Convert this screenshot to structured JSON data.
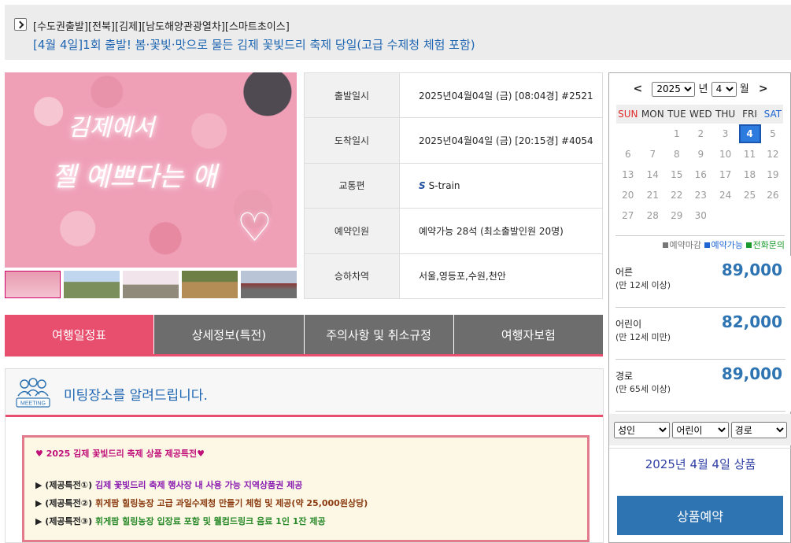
{
  "header": {
    "category": "[수도권출발][전북][김제][남도해양관광열차][스마트초이스]",
    "title": "[4월 4일]1회 출발! 봄·꽃빛·맛으로 물든 김제 꽃빛드리 축제 당일(고급 수제청 체험 포함)"
  },
  "gallery": {
    "photo_text_line1": "김제에서",
    "photo_text_line2": "젤 예쁘다는 애"
  },
  "info": {
    "rows": [
      {
        "label": "출발일시",
        "value": "2025년04월04일 (금) [08:04경] #2521"
      },
      {
        "label": "도착일시",
        "value": "2025년04월04일 (금) [20:15경] #4054"
      },
      {
        "label": "교통편",
        "value": "S-train",
        "logo": "S"
      },
      {
        "label": "예약인원",
        "value": "예약가능 28석 (최소출발인원  20명)"
      },
      {
        "label": "승하차역",
        "value": "서울,영등포,수원,천안"
      }
    ]
  },
  "tabs": [
    "여행일정표",
    "상세정보(특전)",
    "주의사항 및 취소규정",
    "여행자보험"
  ],
  "meeting": {
    "icon_label": "MEETING",
    "title": "미팅장소를 알려드립니다."
  },
  "benefit": {
    "head": "♥ 2025 김제 꽃빛드리 축제 상품 제공특전♥",
    "items": [
      {
        "prefix": "▶ (제공특전①) ",
        "text": "김제 꽃빛드리 축제 행사장 내 사용 가능 지역상품권 제공"
      },
      {
        "prefix": "▶ (제공특전②) ",
        "text": "휘게팜 힐링농장 고급 과일수제청 만들기 체험 및 제공(약 25,000원상당)"
      },
      {
        "prefix": "▶ (제공특전③) ",
        "text": "휘게팜 힐링농장 입장료 포함 및 웰컴드링크 음료 1인 1잔 제공"
      }
    ]
  },
  "calendar": {
    "prev": "<",
    "next": ">",
    "year": "2025",
    "year_unit": "년",
    "month": "4",
    "month_unit": "월",
    "weekdays": [
      "SUN",
      "MON",
      "TUE",
      "WED",
      "THU",
      "FRI",
      "SAT"
    ],
    "weeks": [
      [
        "",
        "",
        "1",
        "2",
        "3",
        "4",
        "5"
      ],
      [
        "6",
        "7",
        "8",
        "9",
        "10",
        "11",
        "12"
      ],
      [
        "13",
        "14",
        "15",
        "16",
        "17",
        "18",
        "19"
      ],
      [
        "20",
        "21",
        "22",
        "23",
        "24",
        "25",
        "26"
      ],
      [
        "27",
        "28",
        "29",
        "30",
        "",
        "",
        ""
      ]
    ],
    "selected_day": "4",
    "legend": [
      "예약마감",
      "예약가능",
      "전화문의"
    ]
  },
  "prices": [
    {
      "name": "어른",
      "cond": "(만 12세 이상)",
      "amount": "89,000"
    },
    {
      "name": "어린이",
      "cond": "(만 12세 미만)",
      "amount": "82,000"
    },
    {
      "name": "경로",
      "cond": "(만 65세 이상)",
      "amount": "89,000"
    }
  ],
  "selects": [
    "성인",
    "어린이",
    "경로"
  ],
  "product_date": "2025년 4월 4일 상품",
  "reserve_label": "상품예약",
  "colors": {
    "accent_pink": "#e84f6e",
    "tab_gray": "#6d6d6d",
    "price_blue": "#2f74b2",
    "link_blue": "#1f66b2"
  }
}
